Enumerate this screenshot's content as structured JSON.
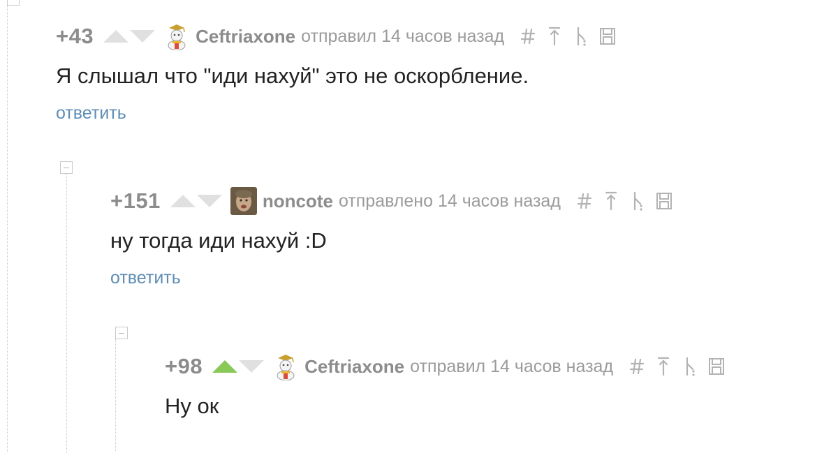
{
  "comments": [
    {
      "rating": "+43",
      "username": "Ceftriaxone",
      "meta": "отправил 14 часов назад",
      "text": "Я слышал что \"иди нахуй\" это не оскорбление.",
      "reply_label": "ответить",
      "upvoted": false
    },
    {
      "rating": "+151",
      "username": "noncote",
      "meta": "отправлено 14 часов назад",
      "text": "ну тогда иди нахуй :D",
      "reply_label": "ответить",
      "upvoted": false
    },
    {
      "rating": "+98",
      "username": "Ceftriaxone",
      "meta": "отправил 14 часов назад",
      "text": "Ну ок",
      "upvoted": true
    }
  ],
  "icons": {
    "link": "hash-icon",
    "parent": "arrow-up-icon",
    "branch": "branch-icon",
    "save": "save-icon"
  },
  "colors": {
    "rating": "#8c8c8c",
    "vote_inactive": "#e0e0e0",
    "vote_active": "#8ac858",
    "reply_link": "#5d8db5",
    "comment_text": "#222222",
    "meta_text": "#9b9b9b"
  }
}
